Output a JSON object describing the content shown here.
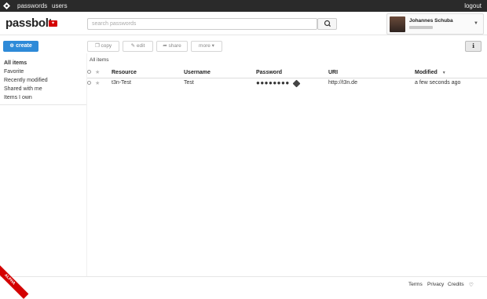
{
  "topbar": {
    "nav_passwords": "passwords",
    "nav_users": "users",
    "logout": "logout"
  },
  "brand": {
    "name": "passbolt"
  },
  "search": {
    "placeholder": "search passwords"
  },
  "user": {
    "name": "Johannes Schuba"
  },
  "actions": {
    "create": "create",
    "copy": "copy",
    "edit": "edit",
    "share": "share",
    "more": "more"
  },
  "sidebar": {
    "items": [
      {
        "label": "All items"
      },
      {
        "label": "Favorite"
      },
      {
        "label": "Recently modified"
      },
      {
        "label": "Shared with me"
      },
      {
        "label": "Items I own"
      }
    ]
  },
  "breadcrumb": "All items",
  "table": {
    "columns": [
      "Resource",
      "Username",
      "Password",
      "URI",
      "Modified"
    ],
    "sort_indicator": "▼",
    "rows": [
      {
        "resource": "t3n-Test",
        "username": "Test",
        "password": "●●●●●●●●",
        "uri": "http://t3n.de",
        "modified": "a few seconds ago"
      }
    ]
  },
  "footer": {
    "terms": "Terms",
    "privacy": "Privacy",
    "credits": "Credits",
    "heart": "♡"
  },
  "badge": "ALPHA",
  "colors": {
    "accent": "#2e8ad8",
    "brand": "#d40101",
    "topbar": "#2a2a2a"
  }
}
